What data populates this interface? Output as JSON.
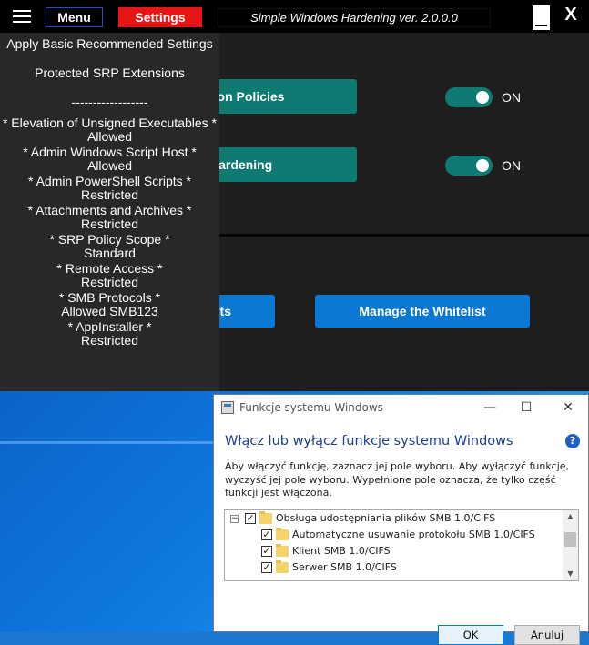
{
  "app": {
    "menu_label": "Menu",
    "settings_label": "Settings",
    "title": "Simple Windows Hardening ver. 2.0.0.0",
    "close_label": "X",
    "policy_buttons": [
      "tion Policies",
      "Hardening"
    ],
    "toggle_labels": [
      "ON",
      "ON"
    ],
    "bottom_buttons": [
      "ts",
      "Manage the Whitelist"
    ],
    "accent_green": "#0e7a72",
    "accent_blue": "#0b78d4",
    "accent_red": "#e81515"
  },
  "side_menu": {
    "items": [
      "Apply Basic Recommended Settings",
      "Protected SRP Extensions",
      "------------------",
      "* Elevation of Unsigned Executables *",
      "Allowed",
      "* Admin Windows Script Host *",
      "Allowed",
      "* Admin PowerShell Scripts *",
      "Restricted",
      "* Attachments and Archives *",
      "Restricted",
      "* SRP Policy Scope *",
      "Standard",
      "* Remote Access *",
      "Restricted",
      "* SMB Protocols *",
      "Allowed SMB123",
      "* AppInstaller *",
      "Restricted"
    ]
  },
  "dialog": {
    "title": "Funkcje systemu Windows",
    "heading": "Włącz lub wyłącz funkcje systemu Windows",
    "help_label": "?",
    "description": "Aby włączyć funkcję, zaznacz jej pole wyboru. Aby wyłączyć funkcję, wyczyść jej pole wyboru. Wypełnione pole oznacza, że tylko część funkcji jest włączona.",
    "tree": [
      {
        "label": "Obsługa udostępniania plików SMB 1.0/CIFS",
        "checked": true,
        "expander": "−"
      },
      {
        "label": "Automatyczne usuwanie protokołu SMB 1.0/CIFS",
        "checked": true
      },
      {
        "label": "Klient SMB 1.0/CIFS",
        "checked": true
      },
      {
        "label": "Serwer SMB 1.0/CIFS",
        "checked": true
      }
    ],
    "ok_label": "OK",
    "cancel_label": "Anuluj",
    "minimize_glyph": "—",
    "maximize_glyph": "☐",
    "close_glyph": "✕"
  }
}
